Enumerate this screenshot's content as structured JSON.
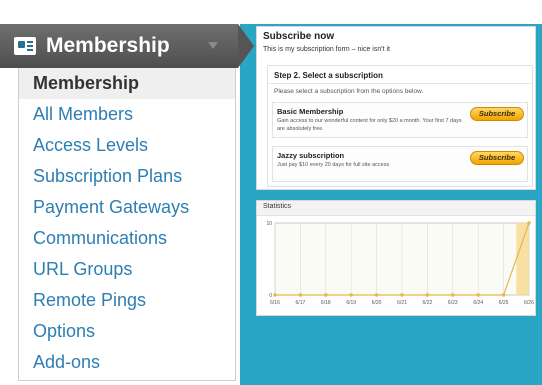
{
  "menu": {
    "title": "Membership",
    "items": [
      {
        "label": "Membership",
        "active": true
      },
      {
        "label": "All Members"
      },
      {
        "label": "Access Levels"
      },
      {
        "label": "Subscription Plans"
      },
      {
        "label": "Payment Gateways"
      },
      {
        "label": "Communications"
      },
      {
        "label": "URL Groups"
      },
      {
        "label": "Remote Pings"
      },
      {
        "label": "Options"
      },
      {
        "label": "Add-ons"
      }
    ]
  },
  "subscribe": {
    "title": "Subscribe now",
    "subtitle": "This is my subscription form – nice isn't it",
    "step_title": "Step 2. Select a subscription",
    "step_desc": "Please select a subscription from the options below.",
    "plans": [
      {
        "name": "Basic Membership",
        "desc": "Gain access to our wonderful content for only $20 a month. Your first 7 days are absolutely free.",
        "button": "Subscribe"
      },
      {
        "name": "Jazzy subscription",
        "desc": "Just pay $10 every 20 days for full site access",
        "button": "Subscribe"
      }
    ]
  },
  "stats": {
    "title": "Statistics"
  },
  "chart_data": {
    "type": "line",
    "title": "Statistics",
    "x": [
      "6/16",
      "6/17",
      "6/18",
      "6/19",
      "6/20",
      "6/21",
      "6/22",
      "6/23",
      "6/24",
      "6/25",
      "6/26"
    ],
    "values": [
      0,
      0,
      0,
      0,
      0,
      0,
      0,
      0,
      0,
      0,
      10
    ],
    "ylim": [
      0,
      10
    ],
    "yticks": [
      "10",
      "0"
    ],
    "line_color": "#e5b84a",
    "highlight_color": "#f6d98c",
    "grid": true
  }
}
